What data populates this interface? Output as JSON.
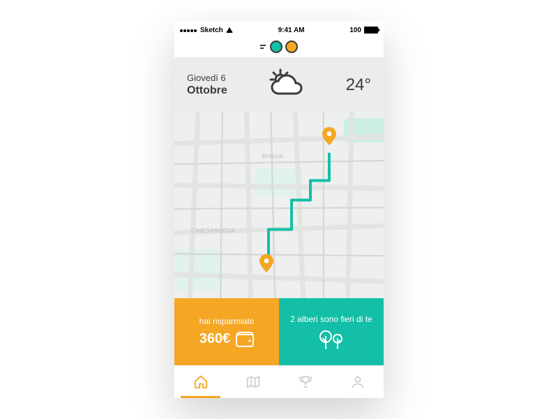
{
  "status": {
    "carrier": "Sketch",
    "time": "9:41 AM",
    "battery": "100"
  },
  "header": {
    "day_line": "Giovedì 6",
    "month_line": "Ottobre",
    "temperature": "24°"
  },
  "map": {
    "city_label": "Brescia",
    "district_label": "CHIESANUOVA"
  },
  "cards": {
    "savings": {
      "caption": "hai risparmiato",
      "value": "360€"
    },
    "trees": {
      "caption": "2 alberi sono fieri di te"
    }
  },
  "colors": {
    "accent_orange": "#f5a623",
    "accent_teal": "#13bfa6"
  }
}
